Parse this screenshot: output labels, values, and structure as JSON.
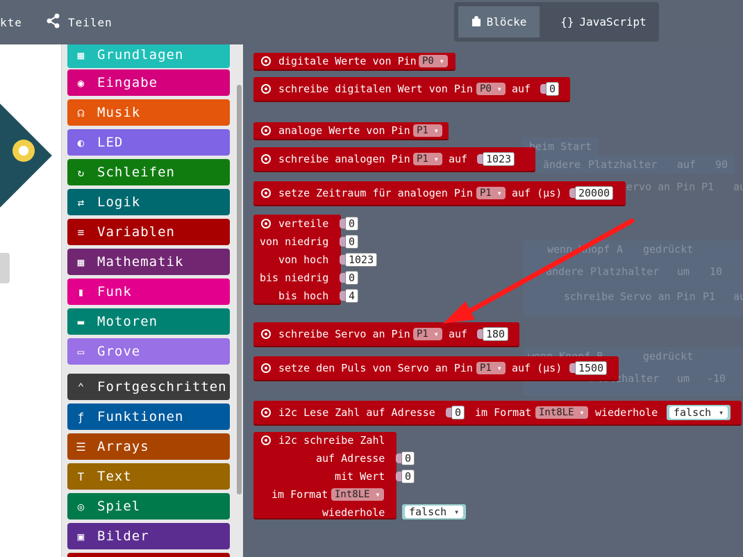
{
  "header": {
    "projects_label": "kte",
    "share_label": "Teilen",
    "blocks_tab": "Blöcke",
    "js_tab": "JavaScript"
  },
  "toolbox": {
    "categories": [
      {
        "label": "Grundlagen",
        "color": "#1fbfb8",
        "icon": "grid-icon"
      },
      {
        "label": "Eingabe",
        "color": "#d4007c",
        "icon": "target-icon"
      },
      {
        "label": "Musik",
        "color": "#e3560b",
        "icon": "headphones-icon"
      },
      {
        "label": "LED",
        "color": "#7f64e6",
        "icon": "toggle-icon"
      },
      {
        "label": "Schleifen",
        "color": "#107c10",
        "icon": "refresh-icon"
      },
      {
        "label": "Logik",
        "color": "#006970",
        "icon": "shuffle-icon"
      },
      {
        "label": "Variablen",
        "color": "#a80000",
        "icon": "lines-icon"
      },
      {
        "label": "Mathematik",
        "color": "#712672",
        "icon": "calculator-icon"
      },
      {
        "label": "Funk",
        "color": "#e3008c",
        "icon": "signal-icon"
      },
      {
        "label": "Motoren",
        "color": "#008272",
        "icon": "car-icon"
      },
      {
        "label": "Grove",
        "color": "#9970e6",
        "icon": "monitor-icon"
      },
      {
        "label": "Fortgeschritten",
        "color": "#3c3c3c",
        "icon": "chevron-up-icon"
      },
      {
        "label": "Funktionen",
        "color": "#005a9e",
        "icon": "function-icon"
      },
      {
        "label": "Arrays",
        "color": "#a94400",
        "icon": "list-icon"
      },
      {
        "label": "Text",
        "color": "#996600",
        "icon": "text-icon"
      },
      {
        "label": "Spiel",
        "color": "#007a4b",
        "icon": "gamepad-icon"
      },
      {
        "label": "Bilder",
        "color": "#5c2d91",
        "icon": "image-icon"
      }
    ]
  },
  "blocks": {
    "digital_read": {
      "label": "digitale Werte von Pin",
      "pin": "P0"
    },
    "digital_write": {
      "label": "schreibe digitalen Wert von Pin",
      "pin": "P0",
      "auf": "auf",
      "value": "0"
    },
    "analog_read": {
      "label": "analoge Werte von Pin",
      "pin": "P1"
    },
    "analog_write": {
      "label": "schreibe analogen Pin",
      "pin": "P1",
      "auf": "auf",
      "value": "1023"
    },
    "analog_period": {
      "label": "setze Zeitraum für analogen Pin",
      "pin": "P1",
      "unit": "auf (µs)",
      "value": "20000"
    },
    "map": {
      "label": "verteile",
      "value": "0",
      "from_low_label": "von niedrig",
      "from_low": "0",
      "from_high_label": "von hoch",
      "from_high": "1023",
      "to_low_label": "bis niedrig",
      "to_low": "0",
      "to_high_label": "bis hoch",
      "to_high": "4"
    },
    "servo_write": {
      "label": "schreibe Servo an Pin",
      "pin": "P1",
      "auf": "auf",
      "value": "180"
    },
    "servo_pulse": {
      "label": "setze den Puls von Servo an Pin",
      "pin": "P1",
      "unit": "auf (µs)",
      "value": "1500"
    },
    "i2c_read": {
      "label": "i2c Lese Zahl auf Adresse",
      "address": "0",
      "format_label": "im Format",
      "format": "Int8LE",
      "repeat_label": "wiederhole",
      "repeat": "falsch"
    },
    "i2c_write": {
      "label": "i2c schreibe Zahl",
      "address_label": "auf Adresse",
      "address": "0",
      "value_label": "mit Wert",
      "value": "0",
      "format_label": "im Format",
      "format": "Int8LE",
      "repeat_label": "wiederhole",
      "repeat": "falsch"
    }
  },
  "background_blocks": {
    "on_start": "beim Start",
    "change_label": "ändere",
    "placeholder": "Platzhalter",
    "by_label": "um",
    "to_label": "auf",
    "val_90": "90",
    "servo_frag": "ervo an Pin",
    "pin": "P1",
    "au": "au",
    "button_a": "wenn Knopf",
    "a": "A",
    "pressed": "gedrückt",
    "val_10": "10",
    "servo_write": "schreibe Servo an Pin",
    "button_b": "wenn Knopf B",
    "val_m10": "-10"
  }
}
